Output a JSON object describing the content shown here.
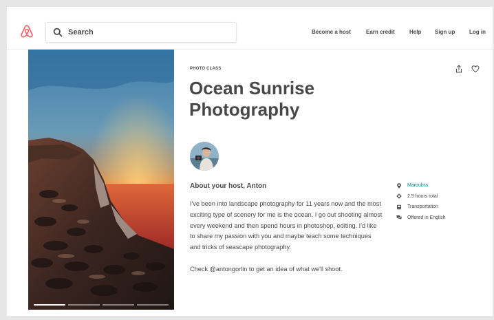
{
  "header": {
    "search_placeholder": "Search",
    "nav": [
      "Become a host",
      "Earn credit",
      "Help",
      "Sign up",
      "Log in"
    ]
  },
  "experience": {
    "kicker": "PHOTO CLASS",
    "title": "Ocean Sunrise Photography",
    "host_heading": "About your host, Anton",
    "bio": [
      "I've been into landscape photography for 11 years now and the most exciting type of scenery for me is the ocean. I go out shooting almost every weekend and then spend hours in photoshop, editing. I'd like to share my passion with you and maybe teach some techniques and tricks of seascape photography.",
      "Check @antongorlin to get an idea of what we'll shoot."
    ],
    "photo_progress": {
      "current": 1,
      "total": 4
    }
  },
  "details": [
    {
      "icon": "location-pin-icon",
      "text": "Maroubra"
    },
    {
      "icon": "clock-diamond-icon",
      "text": "2.5 hours total"
    },
    {
      "icon": "transportation-icon",
      "text": "Transportation"
    },
    {
      "icon": "chat-bubbles-icon",
      "text": "Offered in English"
    }
  ],
  "colors": {
    "brand": "#FF5A5F",
    "text": "#484848",
    "link": "#008489"
  }
}
